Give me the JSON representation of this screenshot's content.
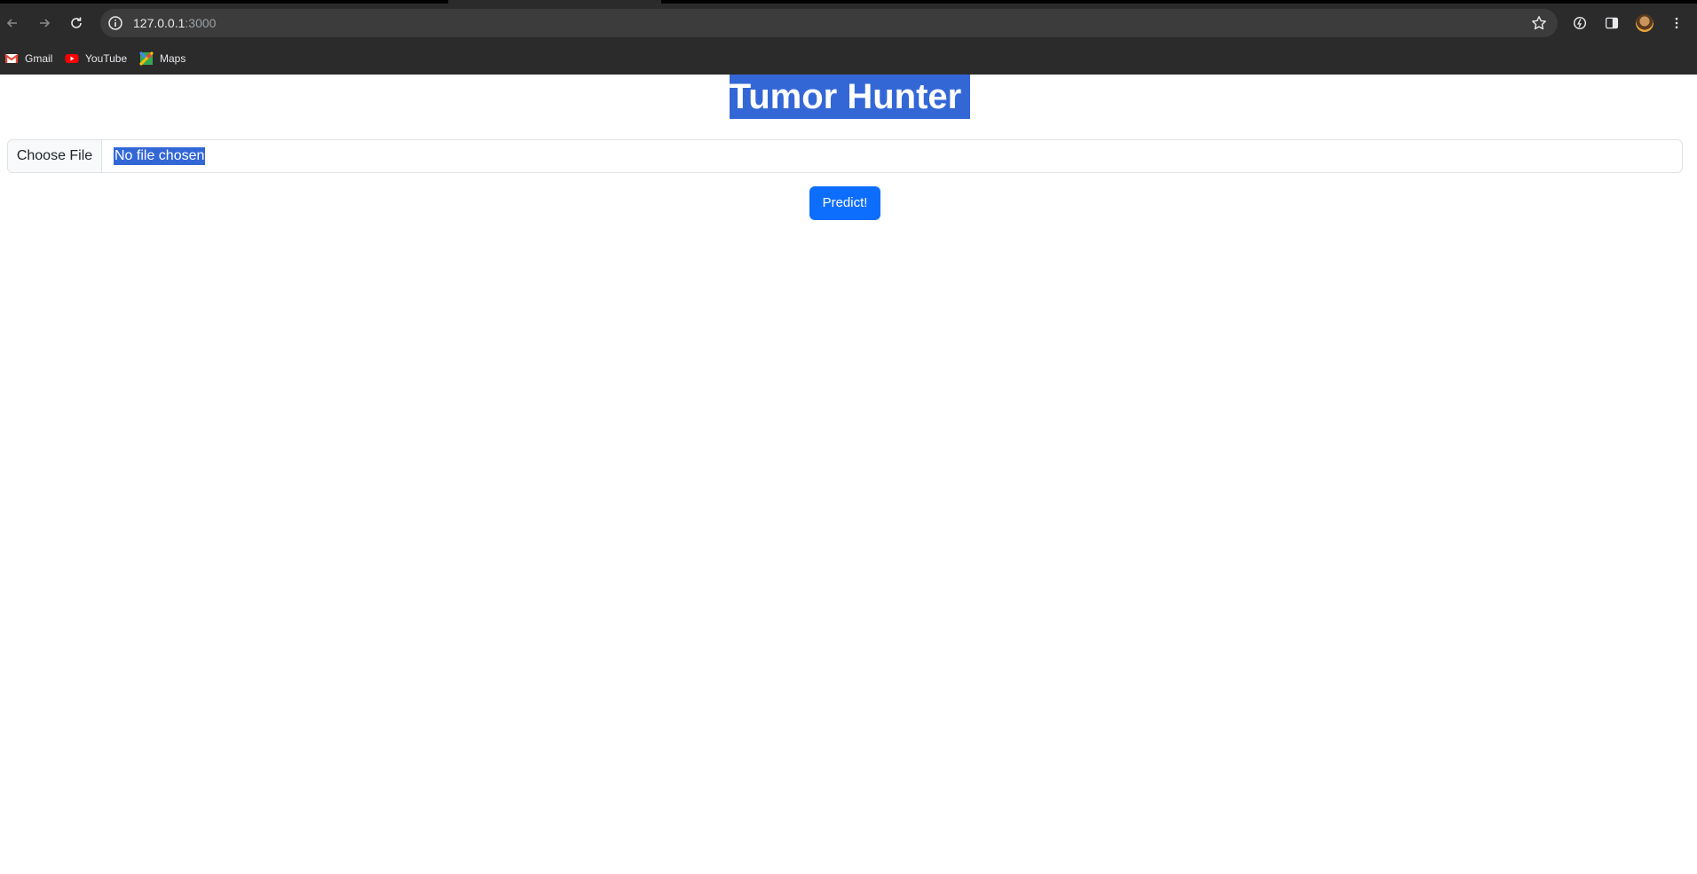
{
  "browser": {
    "url_host": "127.0.0.1",
    "url_port": ":3000",
    "bookmarks": [
      {
        "label": "Gmail",
        "icon": "gmail-icon"
      },
      {
        "label": "YouTube",
        "icon": "youtube-icon"
      },
      {
        "label": "Maps",
        "icon": "maps-icon"
      }
    ]
  },
  "page": {
    "title": "Tumor Hunter",
    "file_button_label": "Choose File",
    "file_status": "No file chosen",
    "predict_label": "Predict!"
  },
  "colors": {
    "accent": "#0d6efd",
    "selection": "#3367d6",
    "chrome": "#2b2b2b"
  }
}
